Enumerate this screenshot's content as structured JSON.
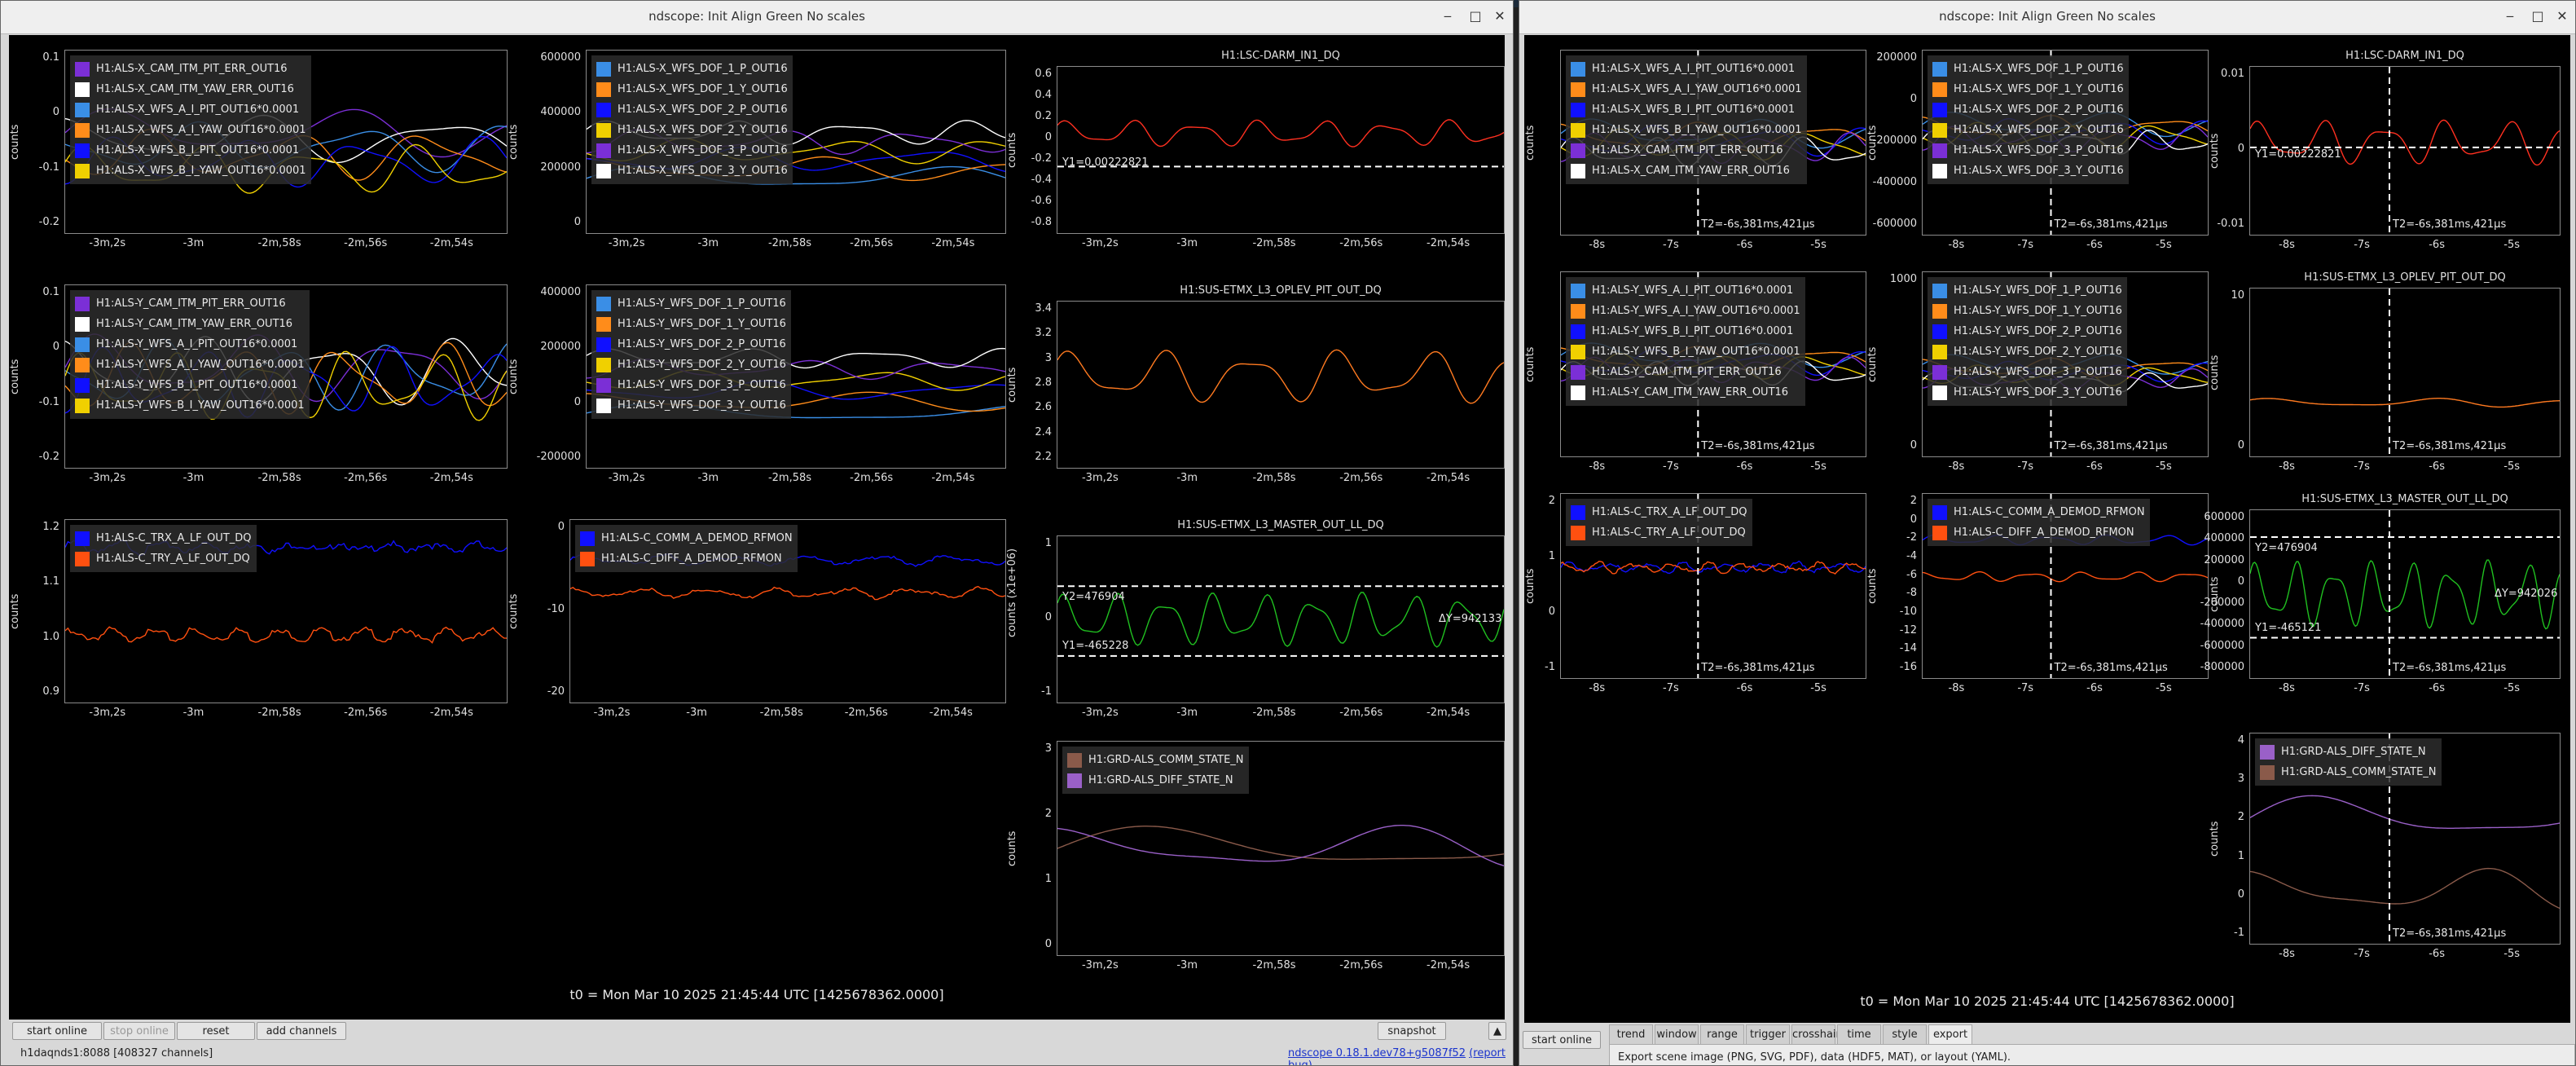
{
  "left_window": {
    "title": "ndscope: Init Align Green No scales",
    "controls": [
      "‒",
      "□",
      "✕"
    ],
    "t0": "t0 = Mon Mar 10 2025 21:45:44 UTC [1425678362.0000]",
    "buttons": {
      "start_online": "start online",
      "stop_online": "stop online",
      "reset": "reset",
      "add_channels": "add channels",
      "snapshot": "snapshot"
    },
    "status": {
      "server": "h1daqnds1:8088  [408327 channels]",
      "version": "ndscope 0.18.1.dev78+g5087f52",
      "report": "(report bug)"
    },
    "xticks": [
      "-3m,2s",
      "-3m",
      "-2m,58s",
      "-2m,56s",
      "-2m,54s"
    ],
    "panels": {
      "p11": {
        "ylabel": "counts",
        "yticks": [
          "0.1",
          "0",
          "-0.1",
          "-0.2"
        ],
        "legend": [
          "H1:ALS-X_CAM_ITM_PIT_ERR_OUT16",
          "H1:ALS-X_CAM_ITM_YAW_ERR_OUT16",
          "H1:ALS-X_WFS_A_I_PIT_OUT16*0.0001",
          "H1:ALS-X_WFS_A_I_YAW_OUT16*0.0001",
          "H1:ALS-X_WFS_B_I_PIT_OUT16*0.0001",
          "H1:ALS-X_WFS_B_I_YAW_OUT16*0.0001"
        ],
        "colors": [
          "#7b2fd6",
          "#ffffff",
          "#3a8ee6",
          "#ff8c1a",
          "#1010ff",
          "#f0d000"
        ]
      },
      "p12": {
        "ylabel": "counts",
        "yticks": [
          "600000",
          "400000",
          "200000",
          "0"
        ],
        "legend": [
          "H1:ALS-X_WFS_DOF_1_P_OUT16",
          "H1:ALS-X_WFS_DOF_1_Y_OUT16",
          "H1:ALS-X_WFS_DOF_2_P_OUT16",
          "H1:ALS-X_WFS_DOF_2_Y_OUT16",
          "H1:ALS-X_WFS_DOF_3_P_OUT16",
          "H1:ALS-X_WFS_DOF_3_Y_OUT16"
        ],
        "colors": [
          "#3a8ee6",
          "#ff8c1a",
          "#1010ff",
          "#f0d000",
          "#7b2fd6",
          "#ffffff"
        ]
      },
      "p13": {
        "title": "H1:LSC-DARM_IN1_DQ",
        "ylabel": "counts",
        "yticks": [
          "0.6",
          "0.4",
          "0.2",
          "0",
          "-0.2",
          "-0.4",
          "-0.6",
          "-0.8"
        ],
        "cursor": "Y1=0.00222821"
      },
      "p21": {
        "ylabel": "counts",
        "yticks": [
          "0.1",
          "0",
          "-0.1",
          "-0.2"
        ],
        "legend": [
          "H1:ALS-Y_CAM_ITM_PIT_ERR_OUT16",
          "H1:ALS-Y_CAM_ITM_YAW_ERR_OUT16",
          "H1:ALS-Y_WFS_A_I_PIT_OUT16*0.0001",
          "H1:ALS-Y_WFS_A_I_YAW_OUT16*0.0001",
          "H1:ALS-Y_WFS_B_I_PIT_OUT16*0.0001",
          "H1:ALS-Y_WFS_B_I_YAW_OUT16*0.0001"
        ],
        "colors": [
          "#7b2fd6",
          "#ffffff",
          "#3a8ee6",
          "#ff8c1a",
          "#1010ff",
          "#f0d000"
        ]
      },
      "p22": {
        "ylabel": "counts",
        "yticks": [
          "400000",
          "200000",
          "0",
          "-200000"
        ],
        "legend": [
          "H1:ALS-Y_WFS_DOF_1_P_OUT16",
          "H1:ALS-Y_WFS_DOF_1_Y_OUT16",
          "H1:ALS-Y_WFS_DOF_2_P_OUT16",
          "H1:ALS-Y_WFS_DOF_2_Y_OUT16",
          "H1:ALS-Y_WFS_DOF_3_P_OUT16",
          "H1:ALS-Y_WFS_DOF_3_Y_OUT16"
        ],
        "colors": [
          "#3a8ee6",
          "#ff8c1a",
          "#1010ff",
          "#f0d000",
          "#7b2fd6",
          "#ffffff"
        ]
      },
      "p23": {
        "title": "H1:SUS-ETMX_L3_OPLEV_PIT_OUT_DQ",
        "ylabel": "counts",
        "yticks": [
          "3.4",
          "3.2",
          "3",
          "2.8",
          "2.6",
          "2.4",
          "2.2"
        ]
      },
      "p31": {
        "ylabel": "counts",
        "yticks": [
          "1.2",
          "1.1",
          "1.0",
          "0.9"
        ],
        "legend": [
          "H1:ALS-C_TRX_A_LF_OUT_DQ",
          "H1:ALS-C_TRY_A_LF_OUT_DQ"
        ],
        "colors": [
          "#1010ff",
          "#ff5010"
        ]
      },
      "p32": {
        "ylabel": "counts",
        "yticks": [
          "0",
          "-10",
          "-20"
        ],
        "legend": [
          "H1:ALS-C_COMM_A_DEMOD_RFMON",
          "H1:ALS-C_DIFF_A_DEMOD_RFMON"
        ],
        "colors": [
          "#1010ff",
          "#ff5010"
        ]
      },
      "p33": {
        "title": "H1:SUS-ETMX_L3_MASTER_OUT_LL_DQ",
        "ylabel": "counts (x1e+06)",
        "yticks": [
          "1",
          "0",
          "-1"
        ],
        "y2": "Y2=476904",
        "y1": "Y1=-465228",
        "dy": "ΔY=942133"
      },
      "p43": {
        "ylabel": "counts",
        "yticks": [
          "3",
          "2",
          "1",
          "0"
        ],
        "legend": [
          "H1:GRD-ALS_COMM_STATE_N",
          "H1:GRD-ALS_DIFF_STATE_N"
        ],
        "colors": [
          "#8a5a4a",
          "#9a60c8"
        ]
      }
    }
  },
  "right_window": {
    "title": "ndscope: Init Align Green No scales",
    "controls": [
      "‒",
      "□",
      "✕"
    ],
    "t0": "t0 = Mon Mar 10 2025 21:45:44 UTC [1425678362.0000]",
    "buttons": {
      "start_online": "start online"
    },
    "tabs": [
      "trend",
      "window",
      "range",
      "trigger",
      "crosshair",
      "time axis",
      "style",
      "export"
    ],
    "export_hint": "Export scene image (PNG, SVG, PDF), data (HDF5, MAT), or layout (YAML).",
    "xticks": [
      "-8s",
      "-7s",
      "-6s",
      "-5s"
    ],
    "t2": "T2=-6s,381ms,421μs",
    "panels": {
      "p11": {
        "ylabel": "counts",
        "yticks": [],
        "legend": [
          "H1:ALS-X_WFS_A_I_PIT_OUT16*0.0001",
          "H1:ALS-X_WFS_A_I_YAW_OUT16*0.0001",
          "H1:ALS-X_WFS_B_I_PIT_OUT16*0.0001",
          "H1:ALS-X_WFS_B_I_YAW_OUT16*0.0001",
          "H1:ALS-X_CAM_ITM_PIT_ERR_OUT16",
          "H1:ALS-X_CAM_ITM_YAW_ERR_OUT16"
        ],
        "colors": [
          "#3a8ee6",
          "#ff8c1a",
          "#1010ff",
          "#f0d000",
          "#7b2fd6",
          "#ffffff"
        ]
      },
      "p12": {
        "ylabel": "counts",
        "yticks": [
          "200000",
          "0",
          "-200000",
          "-400000",
          "-600000"
        ],
        "legend": [
          "H1:ALS-X_WFS_DOF_1_P_OUT16",
          "H1:ALS-X_WFS_DOF_1_Y_OUT16",
          "H1:ALS-X_WFS_DOF_2_P_OUT16",
          "H1:ALS-X_WFS_DOF_2_Y_OUT16",
          "H1:ALS-X_WFS_DOF_3_P_OUT16",
          "H1:ALS-X_WFS_DOF_3_Y_OUT16"
        ],
        "colors": [
          "#3a8ee6",
          "#ff8c1a",
          "#1010ff",
          "#f0d000",
          "#7b2fd6",
          "#ffffff"
        ]
      },
      "p13": {
        "title": "H1:LSC-DARM_IN1_DQ",
        "ylabel": "counts",
        "yticks": [
          "0.01",
          "0",
          "-0.01"
        ],
        "cursor": "Y1=0.00222821"
      },
      "p21": {
        "ylabel": "counts",
        "yticks": [],
        "legend": [
          "H1:ALS-Y_WFS_A_I_PIT_OUT16*0.0001",
          "H1:ALS-Y_WFS_A_I_YAW_OUT16*0.0001",
          "H1:ALS-Y_WFS_B_I_PIT_OUT16*0.0001",
          "H1:ALS-Y_WFS_B_I_YAW_OUT16*0.0001",
          "H1:ALS-Y_CAM_ITM_PIT_ERR_OUT16",
          "H1:ALS-Y_CAM_ITM_YAW_ERR_OUT16"
        ],
        "colors": [
          "#3a8ee6",
          "#ff8c1a",
          "#1010ff",
          "#f0d000",
          "#7b2fd6",
          "#ffffff"
        ]
      },
      "p22": {
        "ylabel": "counts",
        "yticks": [
          "1000",
          "0"
        ],
        "legend": [
          "H1:ALS-Y_WFS_DOF_1_P_OUT16",
          "H1:ALS-Y_WFS_DOF_1_Y_OUT16",
          "H1:ALS-Y_WFS_DOF_2_P_OUT16",
          "H1:ALS-Y_WFS_DOF_2_Y_OUT16",
          "H1:ALS-Y_WFS_DOF_3_P_OUT16",
          "H1:ALS-Y_WFS_DOF_3_Y_OUT16"
        ],
        "colors": [
          "#3a8ee6",
          "#ff8c1a",
          "#1010ff",
          "#f0d000",
          "#7b2fd6",
          "#ffffff"
        ]
      },
      "p23": {
        "title": "H1:SUS-ETMX_L3_OPLEV_PIT_OUT_DQ",
        "ylabel": "counts",
        "yticks": [
          "10",
          "0"
        ]
      },
      "p31": {
        "ylabel": "counts",
        "yticks": [
          "2",
          "1",
          "0",
          "-1"
        ],
        "legend": [
          "H1:ALS-C_TRX_A_LF_OUT_DQ",
          "H1:ALS-C_TRY_A_LF_OUT_DQ"
        ],
        "colors": [
          "#1010ff",
          "#ff5010"
        ]
      },
      "p32": {
        "ylabel": "counts",
        "yticks": [
          "2",
          "0",
          "-2",
          "-4",
          "-6",
          "-8",
          "-10",
          "-12",
          "-14",
          "-16"
        ],
        "legend": [
          "H1:ALS-C_COMM_A_DEMOD_RFMON",
          "H1:ALS-C_DIFF_A_DEMOD_RFMON"
        ],
        "colors": [
          "#1010ff",
          "#ff5010"
        ]
      },
      "p33": {
        "title": "H1:SUS-ETMX_L3_MASTER_OUT_LL_DQ",
        "ylabel": "counts",
        "yticks": [
          "600000",
          "400000",
          "200000",
          "0",
          "-200000",
          "-400000",
          "-600000",
          "-800000"
        ],
        "y2": "Y2=476904",
        "y1": "Y1=-465121",
        "dy": "ΔY=942026"
      },
      "p43": {
        "ylabel": "counts",
        "yticks": [
          "4",
          "3",
          "2",
          "1",
          "0",
          "-1"
        ],
        "legend": [
          "H1:GRD-ALS_DIFF_STATE_N",
          "H1:GRD-ALS_COMM_STATE_N"
        ],
        "colors": [
          "#9a60c8",
          "#8a5a4a"
        ]
      }
    }
  }
}
